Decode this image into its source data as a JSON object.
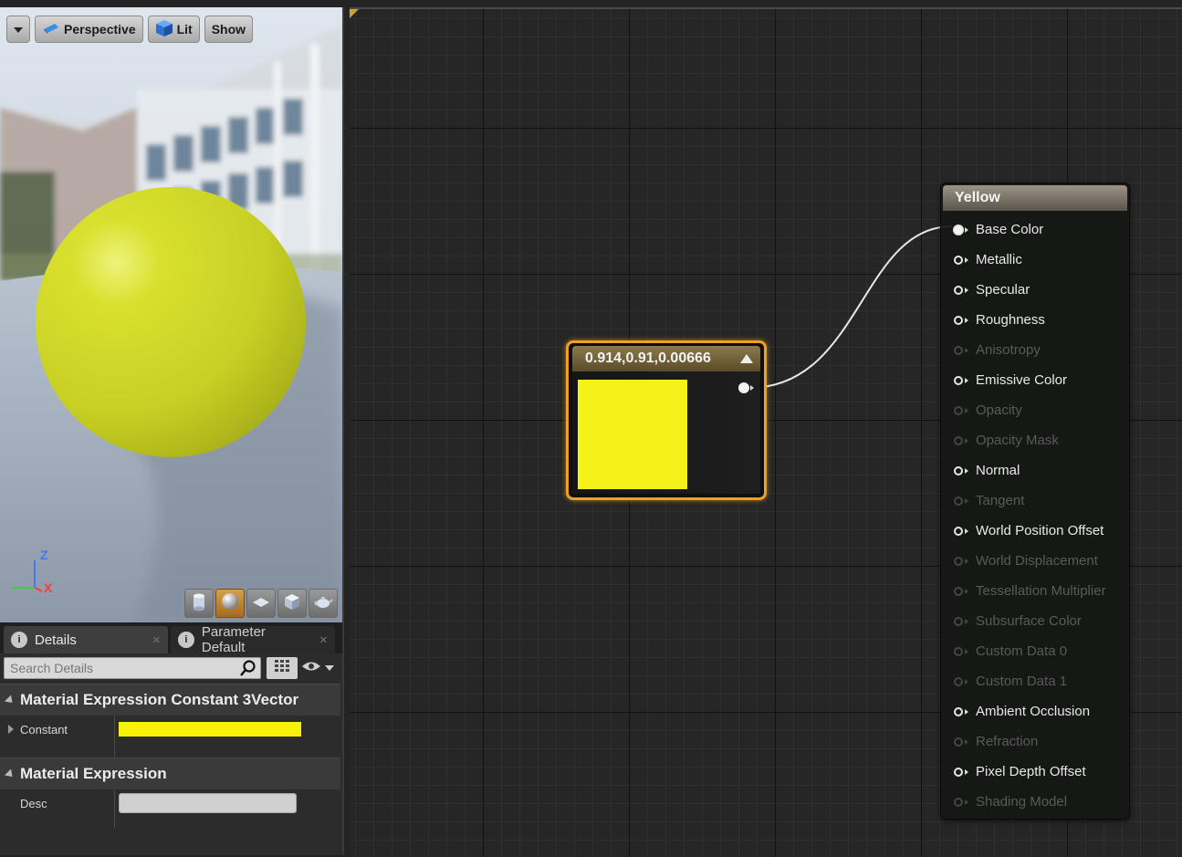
{
  "viewport": {
    "view_mode": "Perspective",
    "lighting_mode": "Lit",
    "show_label": "Show",
    "axis": {
      "z": "Z",
      "x": "X"
    },
    "preview_shapes": [
      "cylinder-icon",
      "sphere-icon",
      "plane-icon",
      "cube-icon",
      "teapot-icon"
    ],
    "active_shape": "sphere-icon",
    "sphere_color": "#d4dc2a"
  },
  "details": {
    "tabs": [
      {
        "label": "Details"
      },
      {
        "label": "Parameter Default"
      }
    ],
    "search_placeholder": "Search Details",
    "categories": [
      {
        "title": "Material Expression Constant 3Vector",
        "properties": [
          {
            "label": "Constant",
            "color": "#f8f20a"
          }
        ]
      },
      {
        "title": "Material Expression",
        "properties": [
          {
            "label": "Desc",
            "value": ""
          }
        ]
      }
    ]
  },
  "graph": {
    "constant_node": {
      "title": "0.914,0.91,0.00666",
      "preview_color": "#f5f21a"
    },
    "result_node": {
      "title": "Yellow",
      "pins": [
        {
          "label": "Base Color",
          "enabled": true,
          "connected": true
        },
        {
          "label": "Metallic",
          "enabled": true
        },
        {
          "label": "Specular",
          "enabled": true
        },
        {
          "label": "Roughness",
          "enabled": true
        },
        {
          "label": "Anisotropy",
          "enabled": false
        },
        {
          "label": "Emissive Color",
          "enabled": true
        },
        {
          "label": "Opacity",
          "enabled": false
        },
        {
          "label": "Opacity Mask",
          "enabled": false
        },
        {
          "label": "Normal",
          "enabled": true
        },
        {
          "label": "Tangent",
          "enabled": false
        },
        {
          "label": "World Position Offset",
          "enabled": true
        },
        {
          "label": "World Displacement",
          "enabled": false
        },
        {
          "label": "Tessellation Multiplier",
          "enabled": false
        },
        {
          "label": "Subsurface Color",
          "enabled": false
        },
        {
          "label": "Custom Data 0",
          "enabled": false
        },
        {
          "label": "Custom Data 1",
          "enabled": false
        },
        {
          "label": "Ambient Occlusion",
          "enabled": true
        },
        {
          "label": "Refraction",
          "enabled": false
        },
        {
          "label": "Pixel Depth Offset",
          "enabled": true
        },
        {
          "label": "Shading Model",
          "enabled": false
        }
      ]
    }
  }
}
